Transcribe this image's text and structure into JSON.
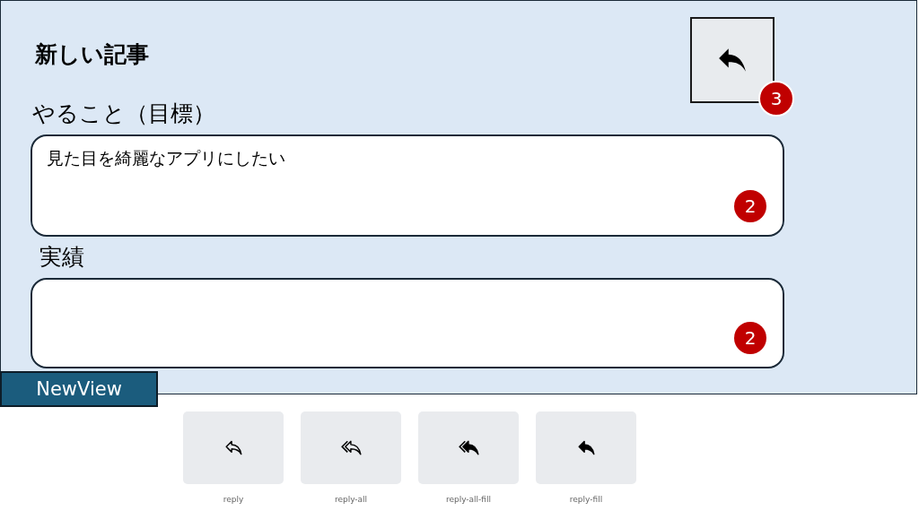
{
  "title": "新しい記事",
  "back_button": {
    "badge": "3"
  },
  "fields": [
    {
      "label": "やること（目標）",
      "value": "見た目を綺麗なアプリにしたい",
      "badge": "2"
    },
    {
      "label": "実績",
      "badge": "2"
    }
  ],
  "view_tag": "NewView",
  "icon_samples": [
    {
      "kind": "reply",
      "label": "reply"
    },
    {
      "kind": "reply-all",
      "label": "reply-all"
    },
    {
      "kind": "reply-all-fill",
      "label": "reply-all-fill"
    },
    {
      "kind": "reply-fill",
      "label": "reply-fill"
    }
  ]
}
